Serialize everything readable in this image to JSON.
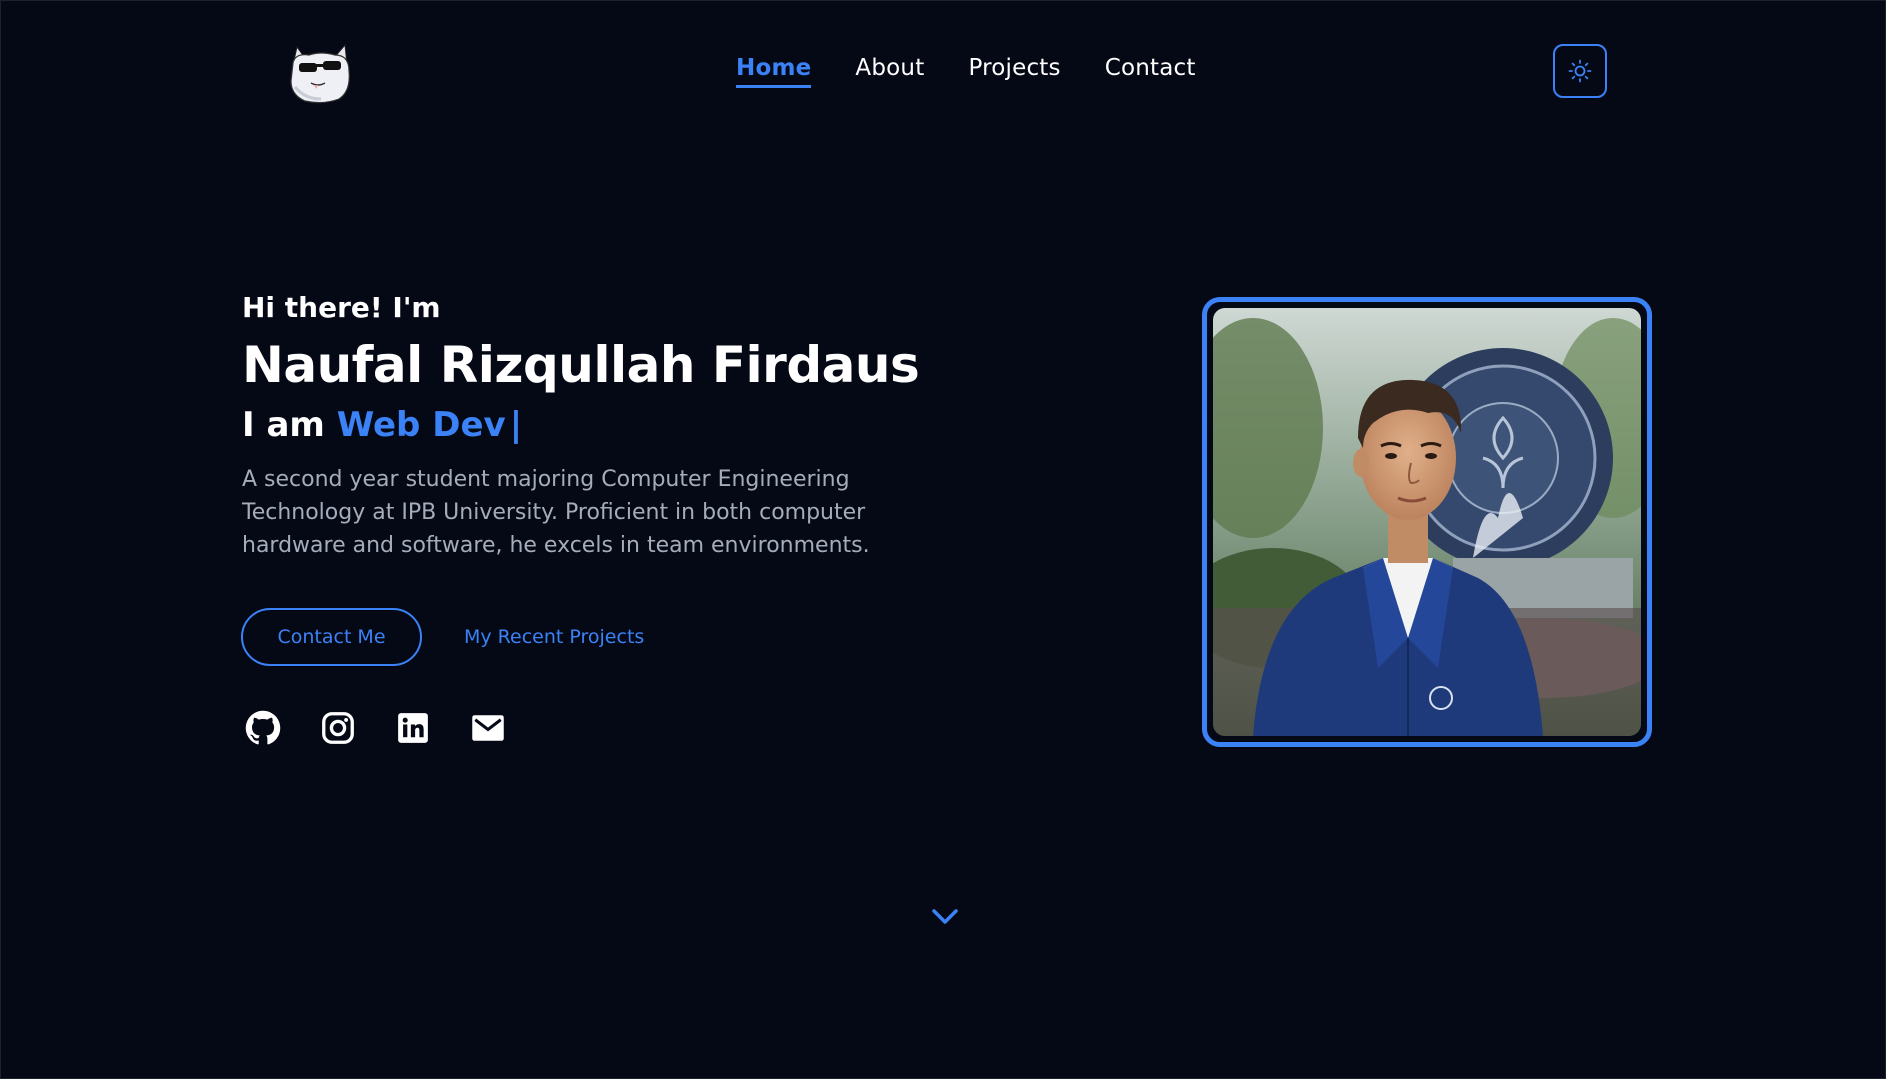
{
  "nav": {
    "items": [
      {
        "label": "Home",
        "active": true
      },
      {
        "label": "About",
        "active": false
      },
      {
        "label": "Projects",
        "active": false
      },
      {
        "label": "Contact",
        "active": false
      }
    ],
    "theme_toggle_icon": "sun-icon"
  },
  "hero": {
    "greeting": "Hi there! I'm",
    "name": "Naufal Rizqullah Firdaus",
    "role_prefix": "I am",
    "role": "Web Dev",
    "caret": "|",
    "description": "A second year student majoring Computer Engineering Technology at IPB University. Proficient in both computer hardware and software, he excels in team environments.",
    "contact_button": "Contact Me",
    "projects_link": "My Recent Projects"
  },
  "socials": [
    "github-icon",
    "instagram-icon",
    "linkedin-icon",
    "mail-icon"
  ],
  "colors": {
    "background": "#050916",
    "accent": "#3b82f6",
    "text": "#ffffff",
    "muted_text": "#a5acba"
  }
}
